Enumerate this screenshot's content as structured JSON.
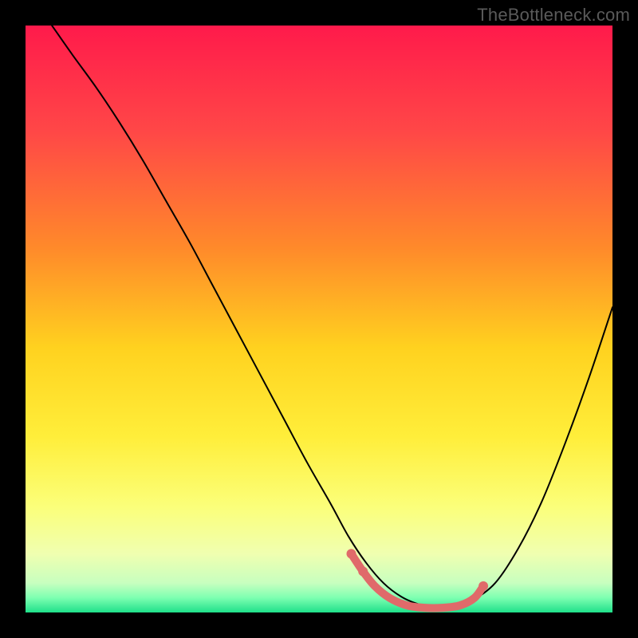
{
  "watermark": "TheBottleneck.com",
  "chart_data": {
    "type": "line",
    "title": "",
    "xlabel": "",
    "ylabel": "",
    "xlim": [
      0,
      100
    ],
    "ylim": [
      0,
      100
    ],
    "grid": false,
    "legend": false,
    "background_gradient": {
      "stops": [
        {
          "offset": 0.0,
          "color": "#ff1a4b"
        },
        {
          "offset": 0.18,
          "color": "#ff4747"
        },
        {
          "offset": 0.38,
          "color": "#ff8a2a"
        },
        {
          "offset": 0.55,
          "color": "#ffd21f"
        },
        {
          "offset": 0.7,
          "color": "#ffee3a"
        },
        {
          "offset": 0.82,
          "color": "#fbff7a"
        },
        {
          "offset": 0.9,
          "color": "#f0ffb0"
        },
        {
          "offset": 0.95,
          "color": "#c7ffbf"
        },
        {
          "offset": 0.975,
          "color": "#7dffb1"
        },
        {
          "offset": 1.0,
          "color": "#1fe08a"
        }
      ]
    },
    "series": [
      {
        "name": "bottleneck-curve",
        "type": "line",
        "color": "#000000",
        "stroke_width": 2,
        "x": [
          4.5,
          8,
          12,
          16,
          20,
          24,
          28,
          32,
          36,
          40,
          44,
          48,
          52,
          55,
          58,
          61,
          64,
          67,
          70,
          73,
          76,
          80,
          84,
          88,
          92,
          96,
          100
        ],
        "y": [
          100,
          95,
          89.5,
          83.5,
          77,
          70,
          63,
          55.5,
          48,
          40.5,
          33,
          25.5,
          18.5,
          13,
          8.5,
          5,
          2.7,
          1.4,
          0.8,
          0.8,
          2,
          5,
          11,
          19,
          29,
          40,
          52
        ]
      },
      {
        "name": "optimal-band",
        "type": "line",
        "color": "#e06a6a",
        "stroke_width": 10,
        "linecap": "round",
        "x": [
          55.5,
          57.5,
          59.5,
          62,
          65,
          68,
          71,
          74,
          76.5,
          78
        ],
        "y": [
          10,
          7,
          4.5,
          2.5,
          1.2,
          0.8,
          0.8,
          1.2,
          2.5,
          4.5
        ]
      }
    ],
    "markers": [
      {
        "name": "dot-left-upper",
        "x": 55.5,
        "y": 10,
        "r": 6,
        "color": "#e06a6a"
      },
      {
        "name": "dot-left-lower",
        "x": 57.5,
        "y": 7,
        "r": 6,
        "color": "#e06a6a"
      },
      {
        "name": "dot-right",
        "x": 78,
        "y": 4.5,
        "r": 6,
        "color": "#e06a6a"
      }
    ]
  }
}
